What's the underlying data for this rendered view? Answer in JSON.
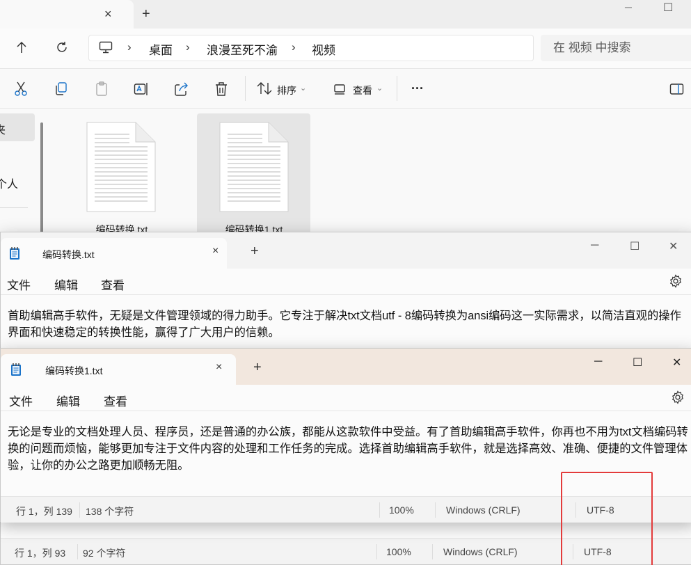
{
  "explorer": {
    "tab_close": "×",
    "tab_add": "+",
    "win_min": "─",
    "win_max": "☐",
    "breadcrumbs": [
      "桌面",
      "浪漫至死不渝",
      "视频"
    ],
    "crumb_sep": "›",
    "search_placeholder": "在 视频 中搜索",
    "toolbar": {
      "sort_label": "排序",
      "view_label": "查看",
      "more_label": "···"
    },
    "sidebar_items": [
      "夹",
      "个人"
    ],
    "files": [
      {
        "name": "编码转换.txt",
        "selected": false
      },
      {
        "name": "编码转换1.txt",
        "selected": true
      }
    ]
  },
  "notepad_back": {
    "tab_title": "编码转换.txt",
    "tab_close": "×",
    "tab_add": "+",
    "win_min": "─",
    "win_max": "☐",
    "win_close": "✕",
    "menu": [
      "文件",
      "编辑",
      "查看"
    ],
    "text": "首助编辑高手软件，无疑是文件管理领域的得力助手。它专注于解决txt文档utf - 8编码转换为ansi编码这一实际需求，以简洁直观的操作界面和快速稳定的转换性能，赢得了广大用户的信赖。",
    "status": {
      "position": "行 1，列 93",
      "chars": "92 个字符",
      "zoom": "100%",
      "line_ending": "Windows (CRLF)",
      "encoding": "UTF-8"
    }
  },
  "notepad_front": {
    "tab_title": "编码转换1.txt",
    "tab_close": "×",
    "tab_add": "+",
    "win_min": "─",
    "win_max": "☐",
    "win_close": "✕",
    "menu": [
      "文件",
      "编辑",
      "查看"
    ],
    "text": "无论是专业的文档处理人员、程序员，还是普通的办公族，都能从这款软件中受益。有了首助编辑高手软件，你再也不用为txt文档编码转换的问题而烦恼，能够更加专注于文件内容的处理和工作任务的完成。选择首助编辑高手软件，就是选择高效、准确、便捷的文件管理体验，让你的办公之路更加顺畅无阻。",
    "status": {
      "position": "行 1，列 139",
      "chars": "138 个字符",
      "zoom": "100%",
      "line_ending": "Windows (CRLF)",
      "encoding": "UTF-8"
    }
  },
  "colors": {
    "highlight": "#e33b3b",
    "notepad_front_titlebar": "#f2e7de",
    "notepad_icon": "#1a73c9"
  }
}
